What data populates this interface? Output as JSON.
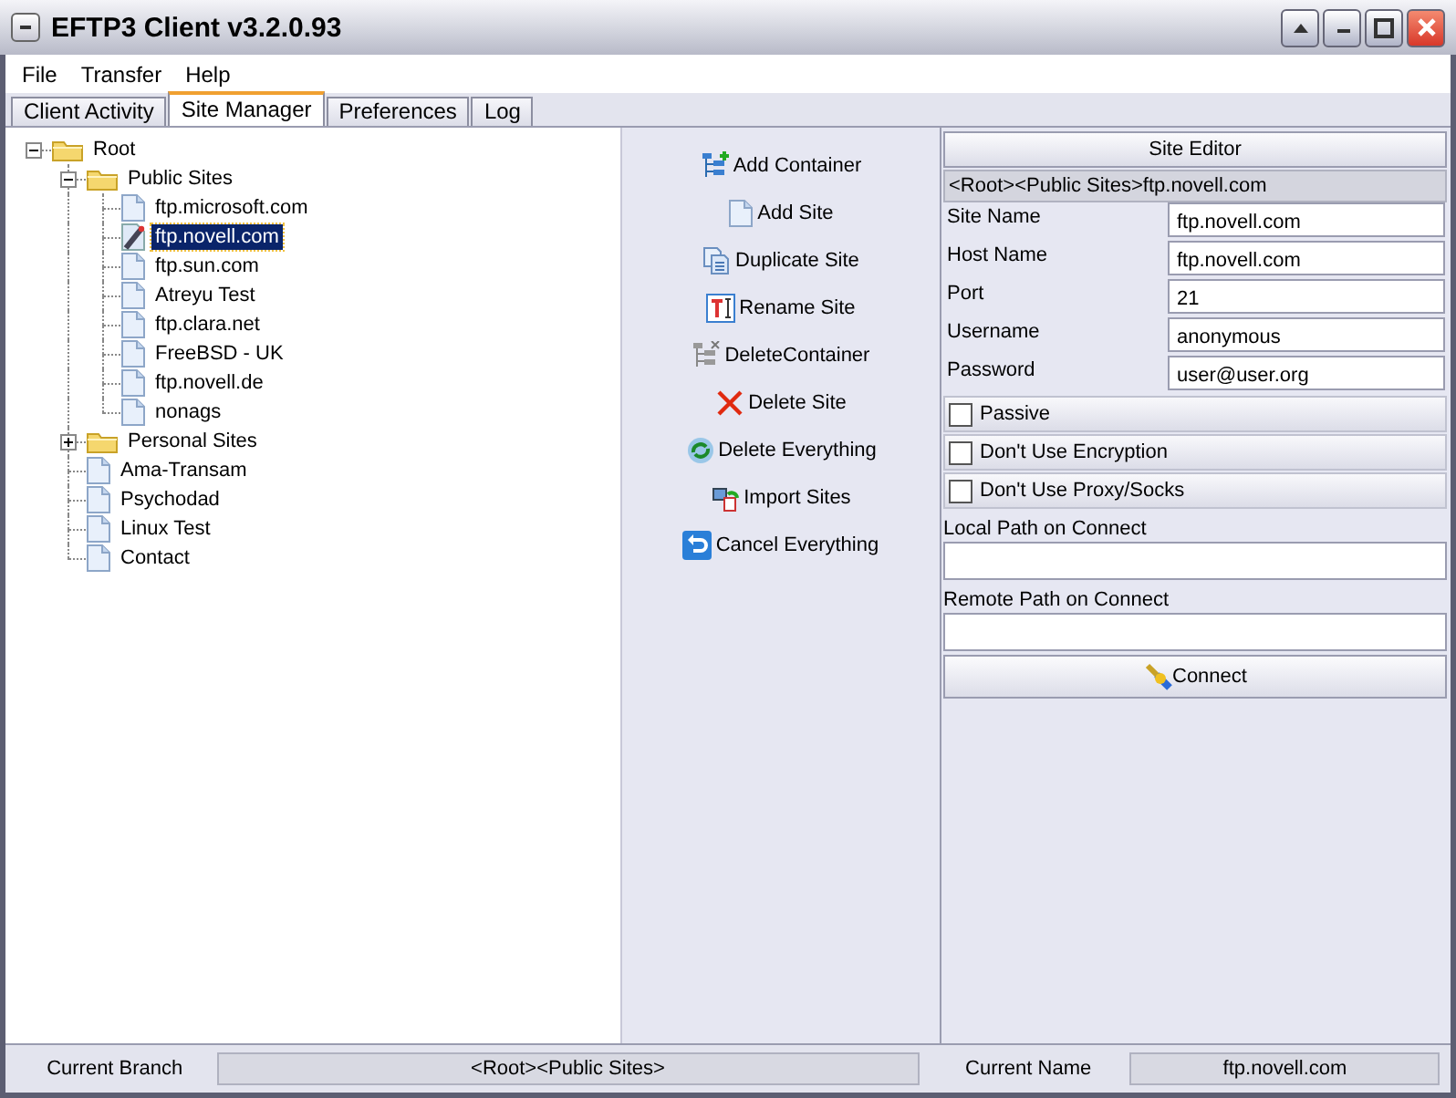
{
  "window": {
    "title": "EFTP3 Client v3.2.0.93"
  },
  "menu": [
    "File",
    "Transfer",
    "Help"
  ],
  "tabs": [
    {
      "label": "Client Activity",
      "selected": false
    },
    {
      "label": "Site Manager",
      "selected": true
    },
    {
      "label": "Preferences",
      "selected": false
    },
    {
      "label": "Log",
      "selected": false
    }
  ],
  "tree": [
    {
      "label": "Root",
      "kind": "folder",
      "expanded": true,
      "selected": false,
      "children": [
        {
          "label": "Public Sites",
          "kind": "folder",
          "expanded": true,
          "selected": false,
          "children": [
            {
              "label": "ftp.microsoft.com",
              "kind": "site",
              "selected": false
            },
            {
              "label": "ftp.novell.com",
              "kind": "site",
              "selected": true
            },
            {
              "label": "ftp.sun.com",
              "kind": "site",
              "selected": false
            },
            {
              "label": "Atreyu Test",
              "kind": "site",
              "selected": false
            },
            {
              "label": "ftp.clara.net",
              "kind": "site",
              "selected": false
            },
            {
              "label": "FreeBSD - UK",
              "kind": "site",
              "selected": false
            },
            {
              "label": "ftp.novell.de",
              "kind": "site",
              "selected": false
            },
            {
              "label": "nonags",
              "kind": "site",
              "selected": false
            }
          ]
        },
        {
          "label": "Personal Sites",
          "kind": "folder",
          "expanded": false,
          "selected": false
        },
        {
          "label": "Ama-Transam",
          "kind": "site",
          "selected": false
        },
        {
          "label": "Psychodad",
          "kind": "site",
          "selected": false
        },
        {
          "label": "Linux Test",
          "kind": "site",
          "selected": false
        },
        {
          "label": "Contact",
          "kind": "site",
          "selected": false
        }
      ]
    }
  ],
  "actions": [
    {
      "label": "Add Container",
      "kind": "add-container"
    },
    {
      "label": "Add Site",
      "kind": "add-site"
    },
    {
      "label": "Duplicate Site",
      "kind": "duplicate"
    },
    {
      "label": "Rename Site",
      "kind": "rename"
    },
    {
      "label": "DeleteContainer",
      "kind": "delete-container"
    },
    {
      "label": "Delete Site",
      "kind": "delete"
    },
    {
      "label": "Delete Everything",
      "kind": "delete-all"
    },
    {
      "label": "Import Sites",
      "kind": "import"
    },
    {
      "label": "Cancel Everything",
      "kind": "cancel"
    }
  ],
  "site_editor": {
    "title": "Site Editor",
    "path": "<Root><Public Sites>ftp.novell.com",
    "fields": [
      {
        "label": "Site Name",
        "value": "ftp.novell.com"
      },
      {
        "label": "Host Name",
        "value": "ftp.novell.com"
      },
      {
        "label": "Port",
        "value": "21"
      },
      {
        "label": "Username",
        "value": "anonymous"
      },
      {
        "label": "Password",
        "value": "user@user.org"
      }
    ],
    "options": [
      {
        "label": "Passive",
        "checked": false
      },
      {
        "label": "Don't Use Encryption",
        "checked": false
      },
      {
        "label": "Don't Use Proxy/Socks",
        "checked": false
      }
    ],
    "paths": [
      {
        "label": "Local Path on Connect"
      },
      {
        "label": "Remote Path on Connect"
      }
    ],
    "connect": "Connect"
  },
  "status_bar": {
    "branch_label": "Current Branch",
    "branch": "<Root><Public Sites>",
    "name_label": "Current Name",
    "name": "ftp.novell.com"
  }
}
